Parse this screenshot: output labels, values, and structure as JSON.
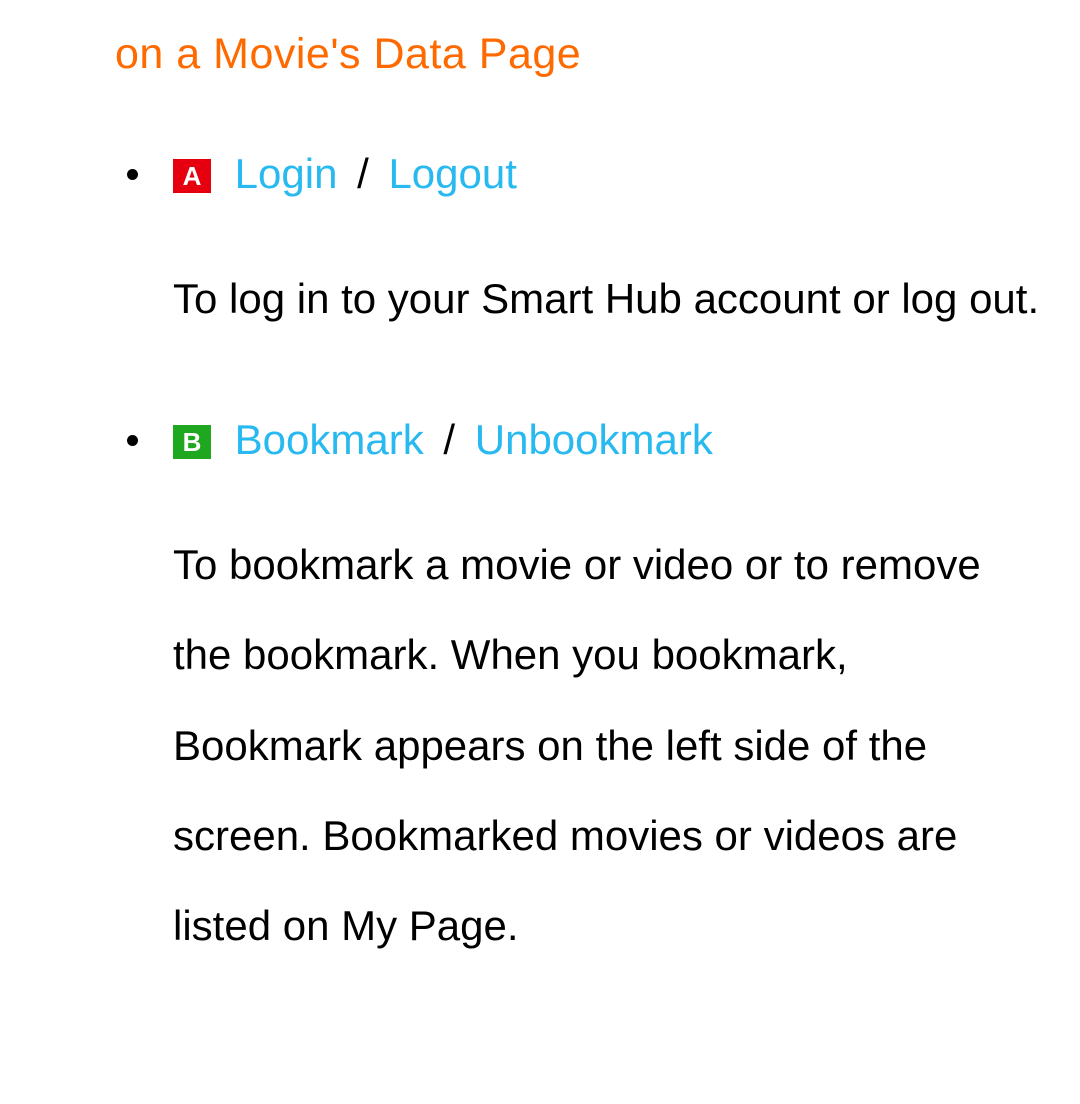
{
  "colors": {
    "heading": "#ff6a00",
    "link": "#27b9ef",
    "badge_a": "#e6000f",
    "badge_b": "#1fa81f"
  },
  "section": {
    "title": "on a Movie's Data Page"
  },
  "items": [
    {
      "badge": {
        "letter": "A",
        "color_key": "badge_a"
      },
      "action1": "Login",
      "action2": "Logout",
      "slash": "/",
      "description": "To log in to your Smart Hub account or log out."
    },
    {
      "badge": {
        "letter": "B",
        "color_key": "badge_b"
      },
      "action1": "Bookmark",
      "action2": "Unbookmark",
      "slash": "/",
      "description": "To bookmark a movie or video or to remove the bookmark. When you bookmark, Bookmark appears on the left side of the screen. Bookmarked movies or videos are listed on My Page."
    }
  ]
}
